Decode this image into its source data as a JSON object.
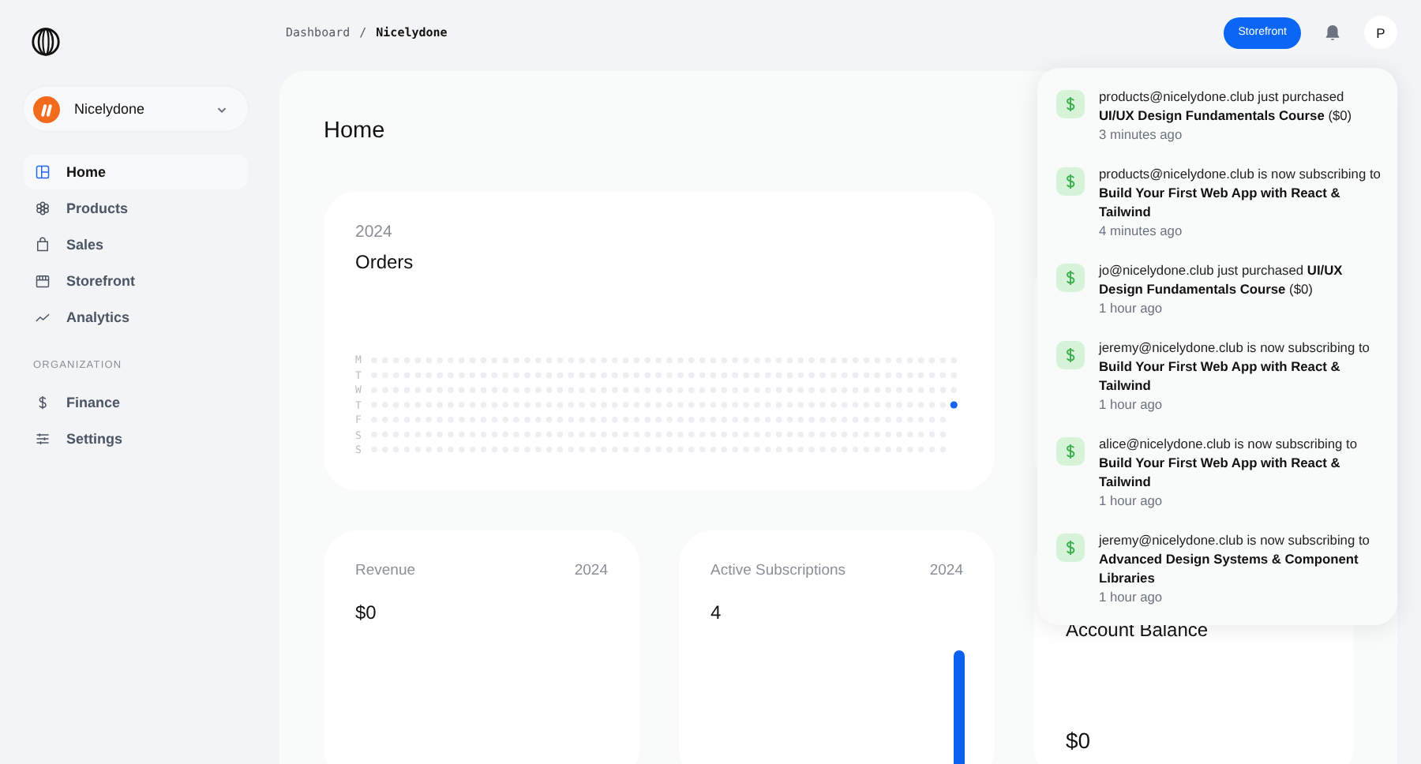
{
  "sidebar": {
    "workspace": {
      "name": "Nicelydone"
    },
    "items": [
      {
        "label": "Home",
        "selected": true
      },
      {
        "label": "Products",
        "selected": false
      },
      {
        "label": "Sales",
        "selected": false
      },
      {
        "label": "Storefront",
        "selected": false
      },
      {
        "label": "Analytics",
        "selected": false
      }
    ],
    "section_label": "ORGANIZATION",
    "org_items": [
      {
        "label": "Finance",
        "selected": false
      },
      {
        "label": "Settings",
        "selected": false
      }
    ]
  },
  "breadcrumbs": [
    {
      "label": "Dashboard",
      "current": false
    },
    {
      "label": "Nicelydone",
      "current": true
    }
  ],
  "separator": "/",
  "header": {
    "storefront_button": "Storefront",
    "avatar": "P"
  },
  "page_title": "Home",
  "orders_card": {
    "year": "2024",
    "title": "Orders",
    "day_labels": [
      "M",
      "T",
      "W",
      "T",
      "F",
      "S",
      "S"
    ]
  },
  "cards": [
    {
      "kind": "revenue",
      "title": "Revenue",
      "year": "2024",
      "value": "$0"
    },
    {
      "kind": "subscriptions",
      "title": "Active Subscriptions",
      "year": "2024",
      "value": "4"
    },
    {
      "kind": "balance",
      "title": "Account Balance",
      "value": "$0"
    }
  ],
  "notifications": [
    {
      "text": "products@nicelydone.club just purchased **UI/UX Design Fundamentals Course** ($0)",
      "time": "3 minutes ago"
    },
    {
      "text": "products@nicelydone.club is now subscribing to **Build Your First Web App with React & Tailwind**",
      "time": "4 minutes ago"
    },
    {
      "text": "jo@nicelydone.club just purchased **UI/UX Design Fundamentals Course** ($0)",
      "time": "1 hour ago"
    },
    {
      "text": "jeremy@nicelydone.club is now subscribing to **Build Your First Web App with React & Tailwind**",
      "time": "1 hour ago"
    },
    {
      "text": "alice@nicelydone.club is now subscribing to **Build Your First Web App with React & Tailwind**",
      "time": "1 hour ago"
    },
    {
      "text": "jeremy@nicelydone.club is now subscribing to **Advanced Design Systems & Component Libraries**",
      "time": "1 hour ago"
    }
  ]
}
